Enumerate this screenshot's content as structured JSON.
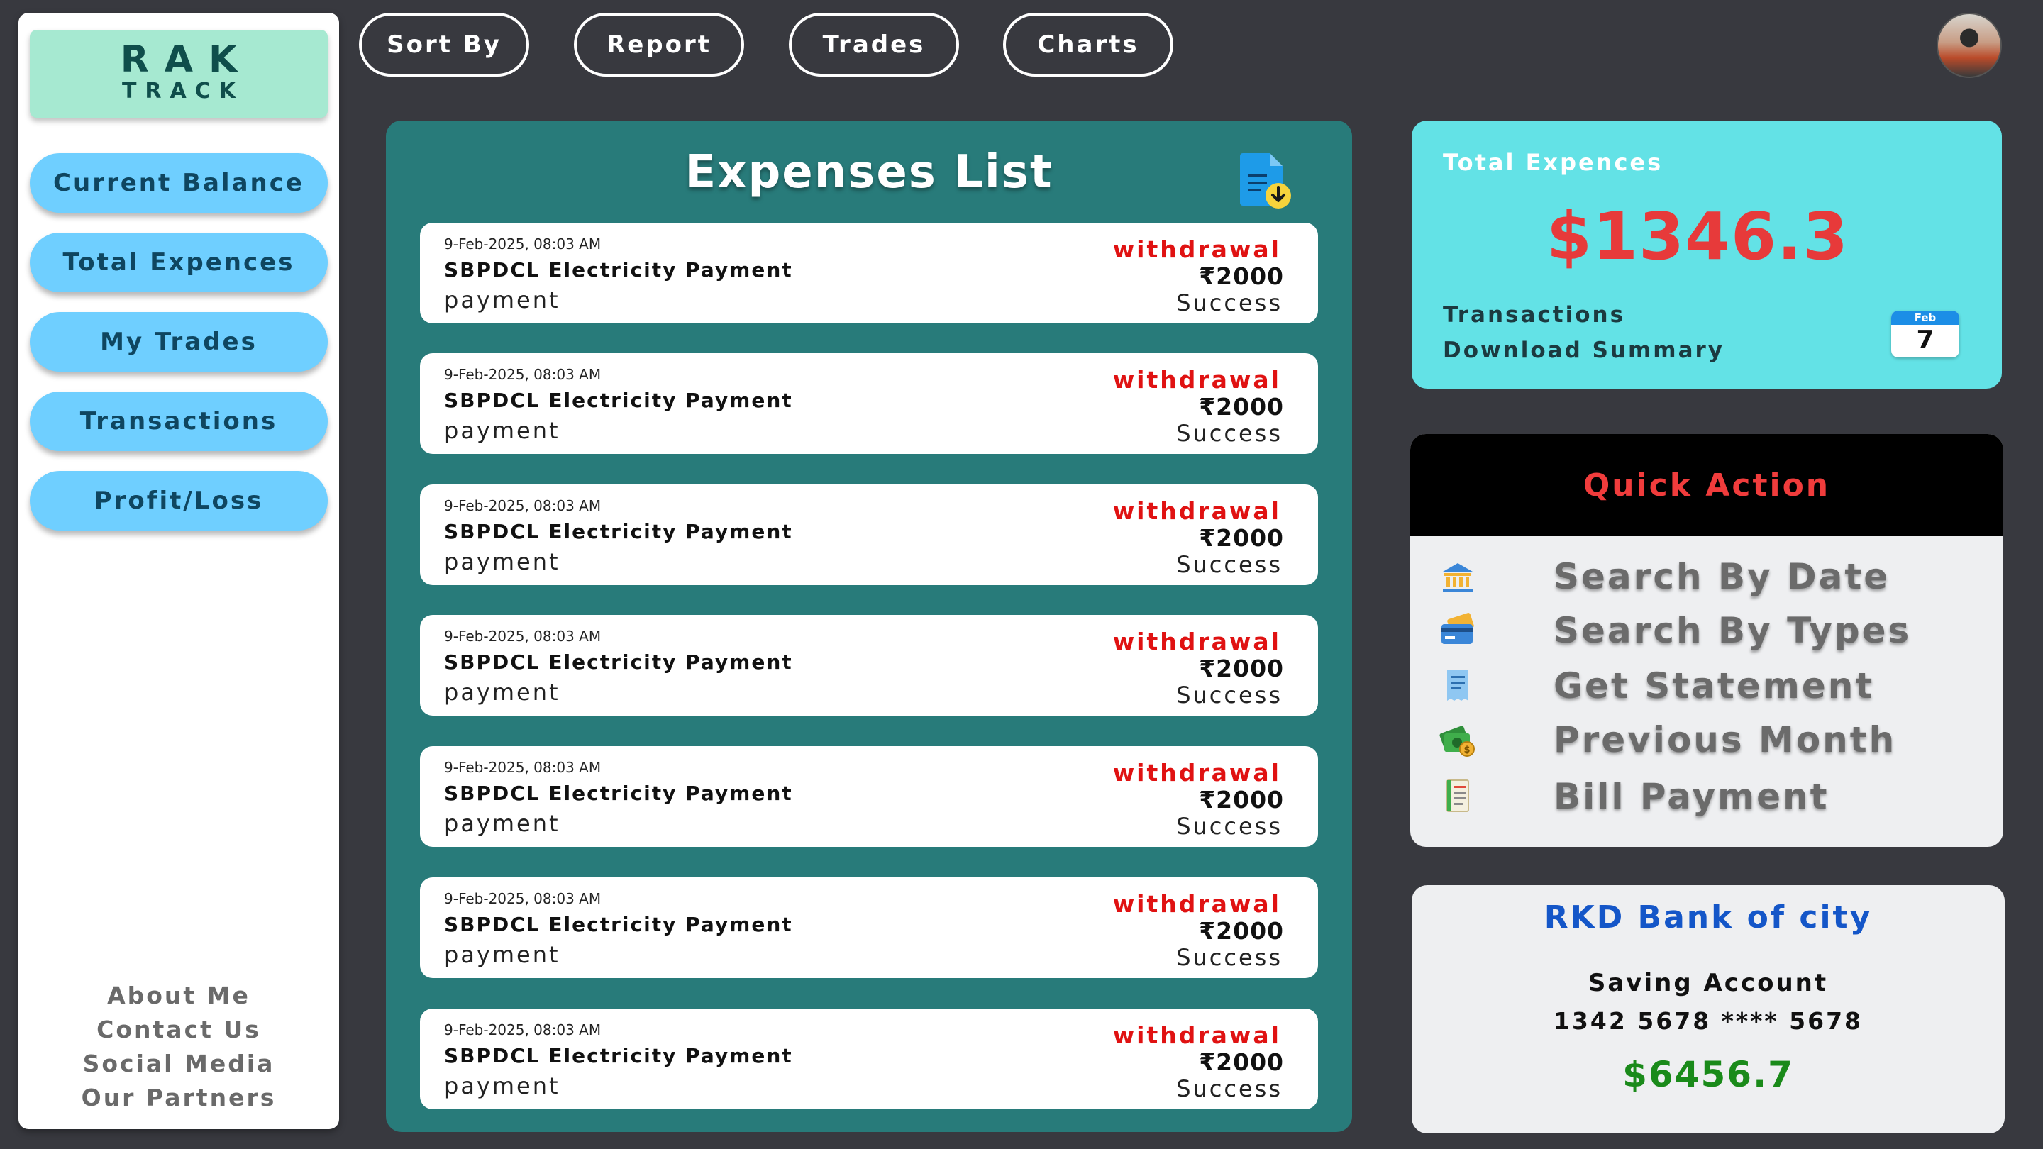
{
  "logo": {
    "line1": "RAK",
    "line2": "TRACK"
  },
  "sidebar": {
    "items": [
      {
        "label": "Current Balance"
      },
      {
        "label": "Total Expences"
      },
      {
        "label": "My Trades"
      },
      {
        "label": "Transactions"
      },
      {
        "label": "Profit/Loss"
      }
    ],
    "footer_links": [
      "About Me",
      "Contact Us",
      "Social Media",
      "Our Partners"
    ]
  },
  "topnav": {
    "buttons": [
      "Sort By",
      "Report",
      "Trades",
      "Charts"
    ]
  },
  "expenses": {
    "title": "Expenses List",
    "items": [
      {
        "date": "9-Feb-2025, 08:03 AM",
        "title": "SBPDCL Electricity Payment",
        "category": "payment",
        "type": "withdrawal",
        "amount": "₹2000",
        "status": "Success"
      },
      {
        "date": "9-Feb-2025, 08:03 AM",
        "title": "SBPDCL Electricity Payment",
        "category": "payment",
        "type": "withdrawal",
        "amount": "₹2000",
        "status": "Success"
      },
      {
        "date": "9-Feb-2025, 08:03 AM",
        "title": "SBPDCL Electricity Payment",
        "category": "payment",
        "type": "withdrawal",
        "amount": "₹2000",
        "status": "Success"
      },
      {
        "date": "9-Feb-2025, 08:03 AM",
        "title": "SBPDCL Electricity Payment",
        "category": "payment",
        "type": "withdrawal",
        "amount": "₹2000",
        "status": "Success"
      },
      {
        "date": "9-Feb-2025, 08:03 AM",
        "title": "SBPDCL Electricity Payment",
        "category": "payment",
        "type": "withdrawal",
        "amount": "₹2000",
        "status": "Success"
      },
      {
        "date": "9-Feb-2025, 08:03 AM",
        "title": "SBPDCL Electricity Payment",
        "category": "payment",
        "type": "withdrawal",
        "amount": "₹2000",
        "status": "Success"
      },
      {
        "date": "9-Feb-2025, 08:03 AM",
        "title": "SBPDCL Electricity Payment",
        "category": "payment",
        "type": "withdrawal",
        "amount": "₹2000",
        "status": "Success"
      }
    ]
  },
  "total_card": {
    "label": "Total Expences",
    "value": "$1346.3",
    "links": [
      "Transactions",
      "Download Summary"
    ],
    "calendar": {
      "month": "Feb",
      "day": "7"
    }
  },
  "quick_action": {
    "title": "Quick Action",
    "items": [
      {
        "label": "Search By Date",
        "icon": "bank-calendar-icon"
      },
      {
        "label": "Search By Types",
        "icon": "credit-card-icon"
      },
      {
        "label": "Get Statement",
        "icon": "receipt-icon"
      },
      {
        "label": "Previous Month",
        "icon": "money-stack-icon"
      },
      {
        "label": "Bill Payment",
        "icon": "bill-icon"
      }
    ]
  },
  "bank": {
    "name": "RKD Bank of city",
    "account_type": "Saving Account",
    "account_number": "1342 5678 **** 5678",
    "balance": "$6456.7"
  },
  "colors": {
    "background": "#38393f",
    "panel_teal": "#287b7a",
    "accent_cyan": "#63e2e6",
    "sidebar_button": "#6fcfff",
    "withdrawal_red": "#e01212",
    "balance_green": "#1a8a1a"
  }
}
